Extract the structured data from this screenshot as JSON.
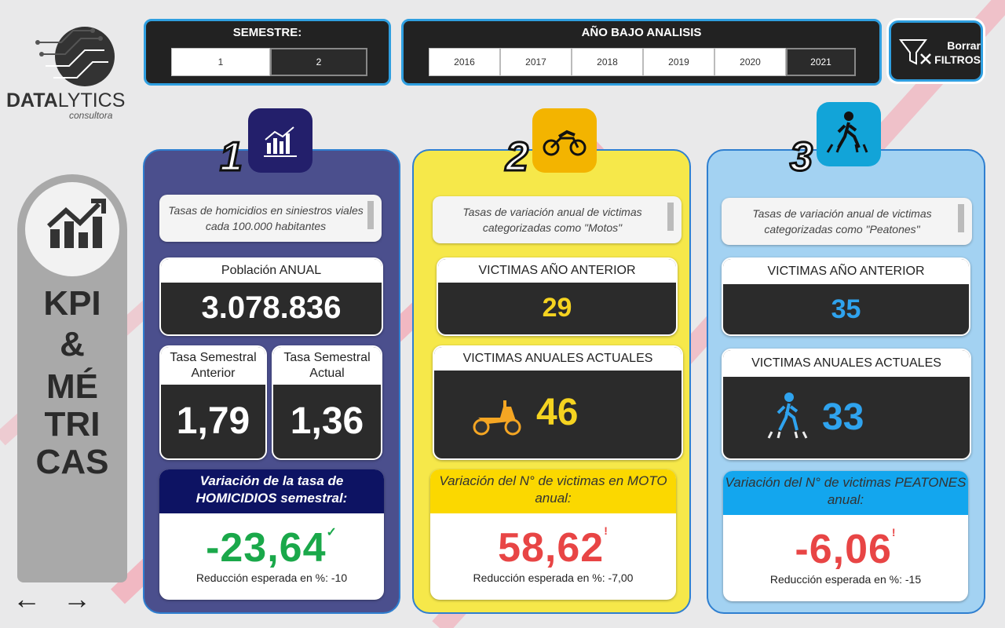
{
  "brand": {
    "name_bold": "DATA",
    "name_light": "LYTICS",
    "sub": "consultora"
  },
  "filters": {
    "semestre": {
      "title": "SEMESTRE:",
      "options": [
        "1",
        "2"
      ],
      "selected": "2"
    },
    "anio": {
      "title": "AÑO BAJO ANALISIS",
      "options": [
        "2016",
        "2017",
        "2018",
        "2019",
        "2020",
        "2021"
      ],
      "selected": "2021"
    },
    "clear": {
      "line1": "Borrar",
      "line2": "FILTROS"
    }
  },
  "side": {
    "line1": "KPI",
    "line2": "&",
    "line3": "MÉ",
    "line4": "TRI",
    "line5": "CAS"
  },
  "panel1": {
    "number": "1",
    "description": "Tasas de homicidios en siniestros viales cada 100.000 habitantes",
    "population_label": "Población ANUAL",
    "population_value": "3.078.836",
    "prev_label": "Tasa Semestral Anterior",
    "prev_value": "1,79",
    "curr_label": "Tasa Semestral Actual",
    "curr_value": "1,36",
    "variation_title": "Variación de la tasa de HOMICIDIOS semestral:",
    "variation_value": "-23,64",
    "expected": "Reducción esperada en %: -10"
  },
  "panel2": {
    "number": "2",
    "description": "Tasas de variación anual de victimas categorizadas como \"Motos\"",
    "prev_label": "VICTIMAS AÑO ANTERIOR",
    "prev_value": "29",
    "curr_label": "VICTIMAS ANUALES ACTUALES",
    "curr_value": "46",
    "variation_title": "Variación del N° de victimas en MOTO anual:",
    "variation_value": "58,62",
    "expected": "Reducción esperada en %: -7,00"
  },
  "panel3": {
    "number": "3",
    "description": "Tasas de variación anual de victimas categorizadas como \"Peatones\"",
    "prev_label": "VICTIMAS AÑO ANTERIOR",
    "prev_value": "35",
    "curr_label": "VICTIMAS ANUALES ACTUALES",
    "curr_value": "33",
    "variation_title": "Variación del N° de victimas PEATONES anual:",
    "variation_value": "-6,06",
    "expected": "Reducción esperada en %: -15"
  },
  "colors": {
    "accent_blue": "#2f9fe0",
    "panel1_bg": "#4b4f8d",
    "panel2_bg": "#f6e84a",
    "panel3_bg": "#a3d2f2",
    "good": "#1aa84a",
    "bad": "#e84545",
    "yellow_value": "#f5d320",
    "blue_value": "#2fa3ee"
  },
  "icons": [
    "chart-icon",
    "motorcycle-icon",
    "pedestrian-crossing-icon",
    "filter-clear-icon",
    "trend-up-icon",
    "scooter-icon",
    "walking-icon",
    "check-icon",
    "warning-icon",
    "arrow-left-icon",
    "arrow-right-icon"
  ]
}
